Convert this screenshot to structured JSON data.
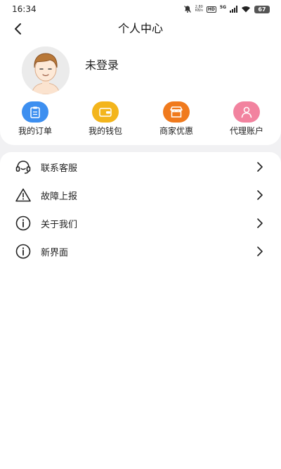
{
  "status_bar": {
    "time": "16:34",
    "net_speed_value": "2.80",
    "net_speed_unit": "KB/s",
    "hd": "HD",
    "network": "5G",
    "battery": "67"
  },
  "header": {
    "title": "个人中心",
    "login_text": "未登录"
  },
  "quick_actions": [
    {
      "label": "我的订单",
      "icon": "order-clipboard-icon",
      "color": "#3d8ff0"
    },
    {
      "label": "我的钱包",
      "icon": "wallet-icon",
      "color": "#f3b51c"
    },
    {
      "label": "商家优惠",
      "icon": "shop-icon",
      "color": "#f07a1d"
    },
    {
      "label": "代理账户",
      "icon": "person-icon",
      "color": "#f2839f"
    }
  ],
  "menu": {
    "items": [
      {
        "label": "联系客服",
        "icon": "headset-icon"
      },
      {
        "label": "故障上报",
        "icon": "warning-icon"
      },
      {
        "label": "关于我们",
        "icon": "info-icon"
      },
      {
        "label": "新界面",
        "icon": "info-icon"
      }
    ]
  },
  "colors": {
    "background": "#f1f1f3",
    "card": "#ffffff",
    "text": "#222222"
  }
}
